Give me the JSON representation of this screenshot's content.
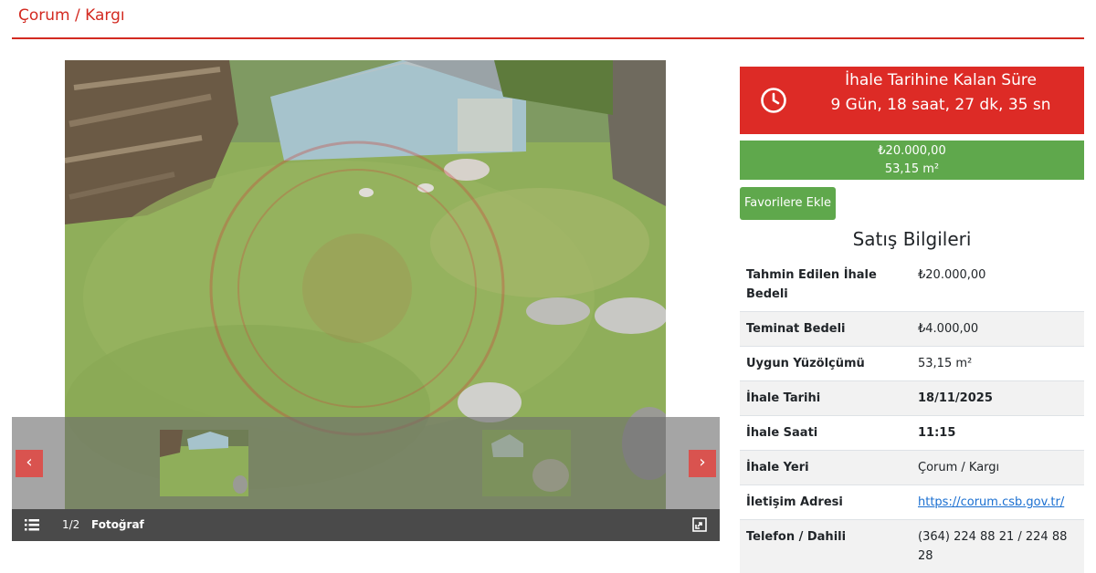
{
  "breadcrumb": "Çorum / Kargı",
  "gallery": {
    "counter": "1/2",
    "title": "Fotoğraf",
    "prev_icon": "chevron-left-icon",
    "next_icon": "chevron-right-icon",
    "menu_icon": "list-icon",
    "expand_icon": "fullscreen-icon"
  },
  "countdown": {
    "title": "İhale Tarihine Kalan Süre",
    "value": "9 Gün, 18 saat, 27 dk, 35 sn",
    "icon": "clock-icon",
    "color": "#dd2b26"
  },
  "price": {
    "amount": "₺20.000,00",
    "area": "53,15 m²",
    "color": "#5fa84c"
  },
  "favorite_button": "Favorilere Ekle",
  "section_title": "Satış Bilgileri",
  "info": [
    {
      "label": "Tahmin Edilen İhale Bedeli",
      "value": "₺20.000,00"
    },
    {
      "label": "Teminat Bedeli",
      "value": "₺4.000,00"
    },
    {
      "label": "Uygun Yüzölçümü",
      "value": "53,15 m²"
    },
    {
      "label": "İhale Tarihi",
      "value": "18/11/2025"
    },
    {
      "label": "İhale Saati",
      "value": "11:15"
    },
    {
      "label": "İhale Yeri",
      "value": "Çorum / Kargı"
    },
    {
      "label": "İletişim Adresi",
      "value": "https://corum.csb.gov.tr/"
    },
    {
      "label": "Telefon / Dahili",
      "value": "(364) 224 88 21 / 224 88 28"
    }
  ]
}
